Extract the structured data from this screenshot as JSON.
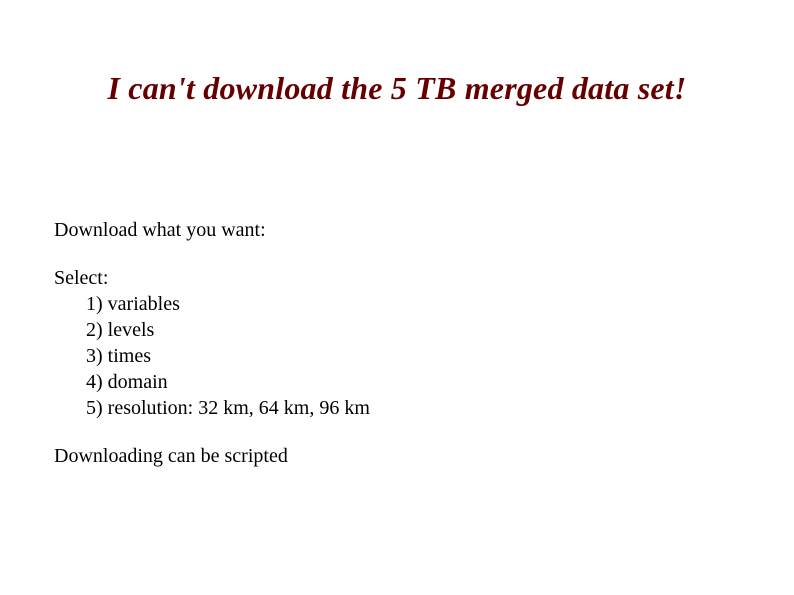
{
  "title": "I can't download the 5 TB merged data set!",
  "intro": "Download what you want:",
  "select_label": "Select:",
  "items": [
    "1) variables",
    "2) levels",
    "3) times",
    "4) domain",
    "5) resolution: 32 km, 64 km, 96 km"
  ],
  "footer": "Downloading can be scripted"
}
